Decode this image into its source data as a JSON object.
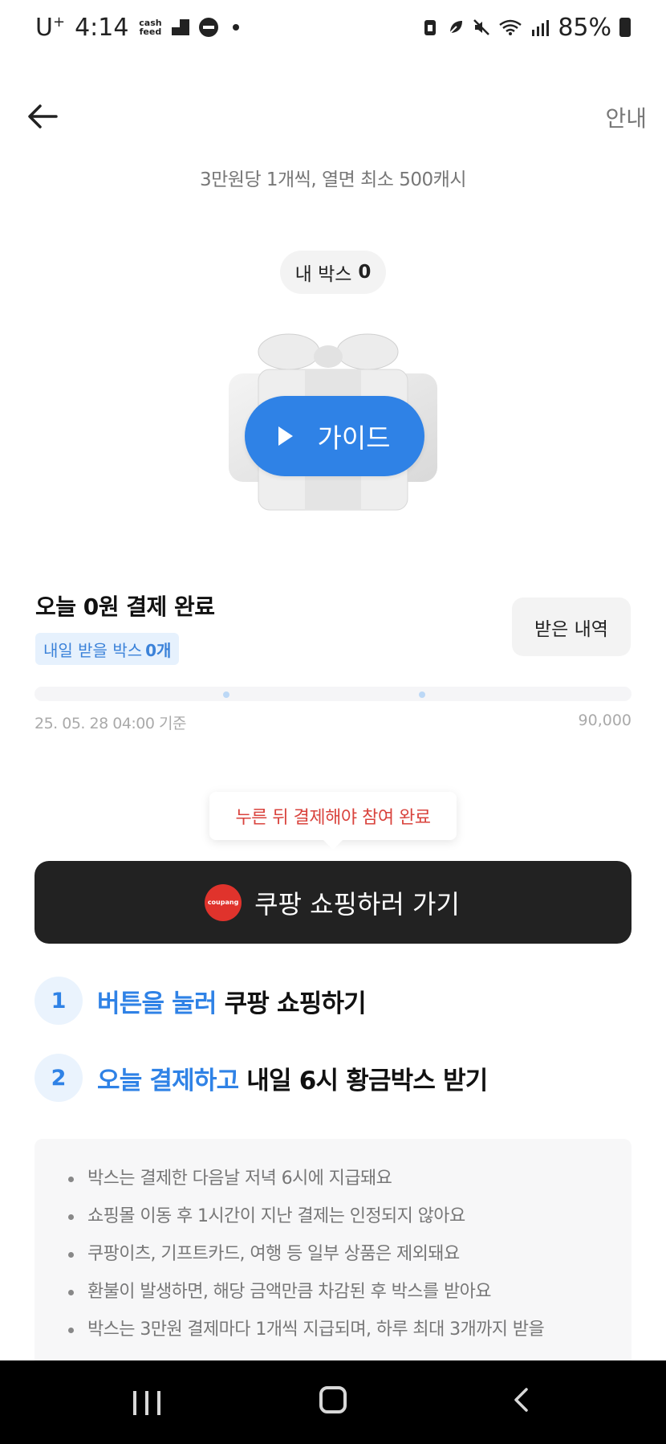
{
  "status_bar": {
    "carrier": "U",
    "carrier_sup": "+",
    "time": "4:14",
    "cash_icon_text": "cash\nfeed",
    "battery": "85%"
  },
  "header": {
    "guide_link": "안내",
    "subtitle": "3만원당 1개씩, 열면 최소 500캐시"
  },
  "my_box": {
    "label": "내 박스",
    "count": "0"
  },
  "guide_button": {
    "label": "가이드"
  },
  "payment": {
    "status": "오늘 0원 결제 완료",
    "badge_label": "내일 받을 박스",
    "badge_count": "0개",
    "history_button": "받은 내역",
    "date": "25. 05. 28 04:00 기준",
    "max": "90,000",
    "progress": 0
  },
  "tooltip": "누른 뒤 결제해야 참여 완료",
  "cta": {
    "logo_text": "coupang",
    "label": "쿠팡 쇼핑하러 가기"
  },
  "steps": [
    {
      "num": "1",
      "highlight": "버튼을 눌러",
      "rest": " 쿠팡 쇼핑하기"
    },
    {
      "num": "2",
      "highlight": "오늘 결제하고",
      "rest": " 내일 6시 황금박스 받기"
    }
  ],
  "notices": [
    "박스는 결제한 다음날 저녁 6시에 지급돼요",
    "쇼핑몰 이동 후 1시간이 지난 결제는 인정되지 않아요",
    "쿠팡이츠, 기프트카드, 여행 등 일부 상품은 제외돼요",
    "환불이 발생하면, 해당 금액만큼 차감된 후 박스를 받아요",
    "박스는 3만원 결제마다 1개씩 지급되며, 하루 최대 3개까지 받을"
  ],
  "colors": {
    "accent": "#2f82e6",
    "cta_bg": "#222222",
    "tooltip_text": "#d9433d",
    "coupang_red": "#e0332c"
  }
}
